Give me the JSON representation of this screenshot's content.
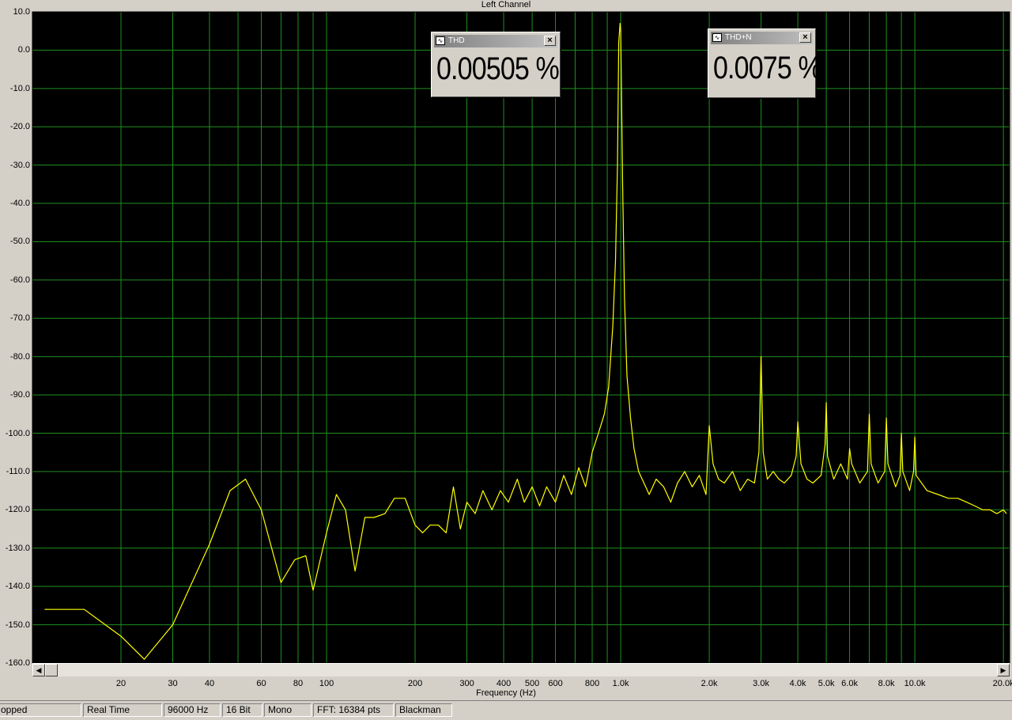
{
  "chart_data": {
    "type": "line",
    "title": "Left Channel",
    "xlabel": "Frequency (Hz)",
    "ylabel": "",
    "x_scale": "log",
    "xlim": [
      10,
      21000
    ],
    "ylim": [
      -160,
      10
    ],
    "grid": true,
    "y_ticks": [
      10,
      0,
      -10,
      -20,
      -30,
      -40,
      -50,
      -60,
      -70,
      -80,
      -90,
      -100,
      -110,
      -120,
      -130,
      -140,
      -150,
      -160
    ],
    "y_tick_labels": [
      "10.0",
      "0.0",
      "-10.0",
      "-20.0",
      "-30.0",
      "-40.0",
      "-50.0",
      "-60.0",
      "-70.0",
      "-80.0",
      "-90.0",
      "-100.0",
      "-110.0",
      "-120.0",
      "-130.0",
      "-140.0",
      "-150.0",
      "-160.0"
    ],
    "x_tick_labels": [
      {
        "value": 20,
        "label": "20"
      },
      {
        "value": 30,
        "label": "30"
      },
      {
        "value": 40,
        "label": "40"
      },
      {
        "value": 60,
        "label": "60"
      },
      {
        "value": 80,
        "label": "80"
      },
      {
        "value": 100,
        "label": "100"
      },
      {
        "value": 200,
        "label": "200"
      },
      {
        "value": 300,
        "label": "300"
      },
      {
        "value": 400,
        "label": "400"
      },
      {
        "value": 500,
        "label": "500"
      },
      {
        "value": 600,
        "label": "600"
      },
      {
        "value": 800,
        "label": "800"
      },
      {
        "value": 1000,
        "label": "1.0k"
      },
      {
        "value": 2000,
        "label": "2.0k"
      },
      {
        "value": 3000,
        "label": "3.0k"
      },
      {
        "value": 4000,
        "label": "4.0k"
      },
      {
        "value": 5000,
        "label": "5.0k"
      },
      {
        "value": 6000,
        "label": "6.0k"
      },
      {
        "value": 8000,
        "label": "8.0k"
      },
      {
        "value": 10000,
        "label": "10.0k"
      },
      {
        "value": 20000,
        "label": "20.0k"
      }
    ],
    "series": [
      {
        "color": "#ffff00",
        "x": [
          11,
          15,
          20,
          24,
          30,
          40,
          47,
          53,
          60,
          70,
          78,
          85,
          90,
          100,
          108,
          116,
          125,
          135,
          145,
          158,
          170,
          185,
          200,
          212,
          225,
          240,
          255,
          270,
          285,
          300,
          320,
          340,
          365,
          390,
          415,
          445,
          470,
          500,
          530,
          560,
          600,
          640,
          680,
          720,
          760,
          800,
          840,
          880,
          910,
          940,
          960,
          975,
          985,
          995,
          1000,
          1005,
          1015,
          1030,
          1050,
          1080,
          1110,
          1150,
          1200,
          1250,
          1320,
          1400,
          1480,
          1560,
          1650,
          1750,
          1850,
          1950,
          2000,
          2060,
          2150,
          2250,
          2400,
          2550,
          2700,
          2850,
          2950,
          3000,
          3050,
          3150,
          3300,
          3450,
          3600,
          3800,
          3950,
          4000,
          4100,
          4300,
          4500,
          4800,
          4950,
          5000,
          5050,
          5300,
          5600,
          5900,
          6000,
          6100,
          6500,
          6900,
          7000,
          7100,
          7500,
          7900,
          8000,
          8100,
          8600,
          8900,
          9000,
          9100,
          9600,
          9900,
          10000,
          10100,
          11000,
          12000,
          13000,
          14000,
          15000,
          16000,
          17000,
          18000,
          19000,
          20000,
          20500
        ],
        "y": [
          -146,
          -146,
          -153,
          -159,
          -150,
          -129,
          -115,
          -112,
          -120,
          -139,
          -133,
          -132,
          -141,
          -126,
          -116,
          -120,
          -136,
          -122,
          -122,
          -121,
          -117,
          -117,
          -124,
          -126,
          -124,
          -124,
          -126,
          -114,
          -125,
          -118,
          -121,
          -115,
          -120,
          -115,
          -118,
          -112,
          -118,
          -114,
          -119,
          -114,
          -118,
          -111,
          -116,
          -109,
          -114,
          -105,
          -100,
          -95,
          -88,
          -72,
          -55,
          -30,
          2,
          7,
          5,
          -8,
          -35,
          -65,
          -85,
          -96,
          -104,
          -110,
          -113,
          -116,
          -112,
          -114,
          -118,
          -113,
          -110,
          -114,
          -111,
          -116,
          -98,
          -108,
          -112,
          -113,
          -110,
          -115,
          -112,
          -113,
          -105,
          -80,
          -105,
          -112,
          -110,
          -112,
          -113,
          -111,
          -106,
          -97,
          -108,
          -112,
          -113,
          -111,
          -103,
          -92,
          -106,
          -112,
          -108,
          -112,
          -104,
          -108,
          -113,
          -110,
          -95,
          -108,
          -113,
          -110,
          -96,
          -108,
          -114,
          -111,
          -100,
          -110,
          -115,
          -110,
          -101,
          -111,
          -115,
          -116,
          -117,
          -117,
          -118,
          -119,
          -120,
          -120,
          -121,
          -120,
          -121
        ]
      }
    ]
  },
  "meters": {
    "thd": {
      "title": "THD",
      "value": "0.00505 %"
    },
    "thdn": {
      "title": "THD+N",
      "value": "0.0075 %"
    }
  },
  "statusbar": {
    "state": "opped",
    "mode": "Real Time",
    "rate": "96000 Hz",
    "bits": "16 Bit",
    "channels": "Mono",
    "fft": "FFT: 16384 pts",
    "window": "Blackman"
  }
}
